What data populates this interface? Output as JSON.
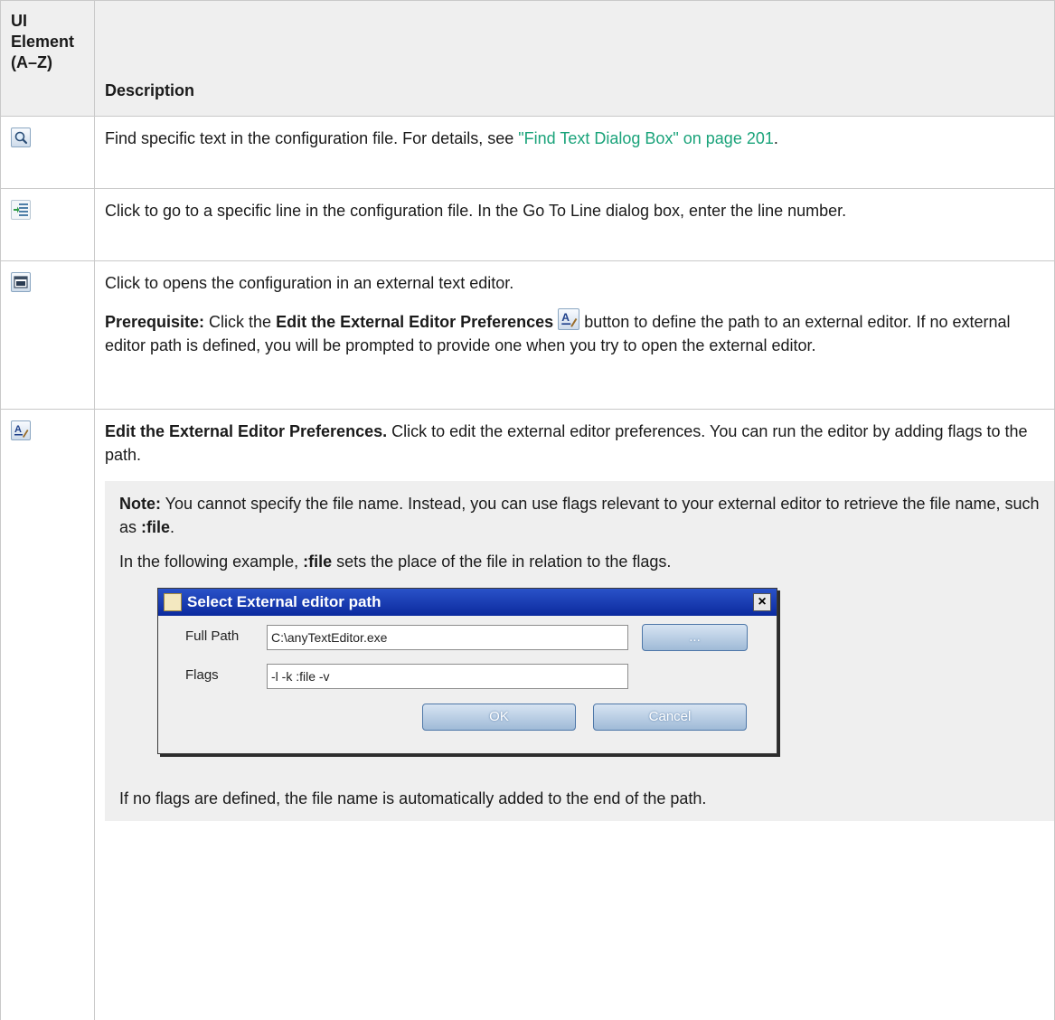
{
  "header": {
    "col1_line1": "UI",
    "col1_line2": "Element",
    "col1_line3": "(A–Z)",
    "col2": "Description"
  },
  "rows": {
    "find": {
      "icon": "search-icon",
      "text_before": "Find specific text in the configuration file. For details, see ",
      "link": "\"Find Text Dialog Box\" on page 201",
      "text_after": "."
    },
    "goto": {
      "icon": "go-to-line-icon",
      "text": "Click to go to a specific line in the configuration file. In the Go To Line dialog box, enter the line number."
    },
    "external": {
      "icon": "external-editor-icon",
      "text": "Click to opens the configuration in an external text editor.",
      "prereq_label": "Prerequisite:",
      "prereq_before": " Click the ",
      "prereq_bold": "Edit the External Editor Preferences",
      "prereq_after": " button to define the path to an external editor. If no external editor path is defined, you will be prompted to provide one when you try to open the external editor."
    },
    "prefs": {
      "icon": "edit-preferences-icon",
      "title": "Edit the External Editor Preferences.",
      "text": " Click to edit the external editor preferences. You can run the editor by adding flags to the path.",
      "note_label": "Note:",
      "note_text": " You cannot specify the file name. Instead, you can use flags relevant to your external editor to retrieve the file name, such as ",
      "note_flag": ":file",
      "note_end": ".",
      "example_before": "In the following example, ",
      "example_flag": ":file",
      "example_after": " sets the place of the file in relation to the flags.",
      "footer": "If no flags are defined, the file name is automatically added to the end of the path."
    }
  },
  "dialog": {
    "title": "Select External editor path",
    "close": "×",
    "full_path_label": "Full Path",
    "full_path_value": "C:\\anyTextEditor.exe",
    "browse_label": "...",
    "flags_label": "Flags",
    "flags_value": "-l -k :file -v",
    "ok_label": "OK",
    "cancel_label": "Cancel"
  }
}
